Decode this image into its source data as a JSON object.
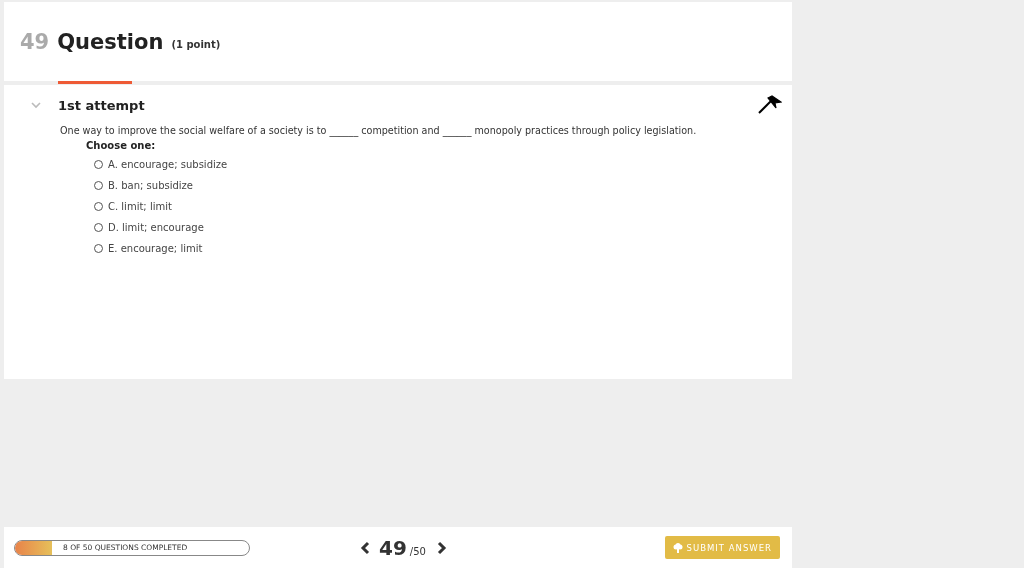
{
  "header": {
    "number": "49",
    "title": "Question",
    "points": "(1 point)"
  },
  "attempt": {
    "title": "1st attempt",
    "flagged": true
  },
  "question": {
    "text": "One way to improve the social welfare of a society is to ______ competition and ______ monopoly practices through policy legislation.",
    "prompt": "Choose one:",
    "options": [
      {
        "label": "A. encourage; subsidize",
        "selected": false
      },
      {
        "label": "B. ban; subsidize",
        "selected": false
      },
      {
        "label": "C. limit; limit",
        "selected": false
      },
      {
        "label": "D. limit; encourage",
        "selected": false
      },
      {
        "label": "E. encourage; limit",
        "selected": false
      }
    ]
  },
  "footer": {
    "progress": {
      "label": "8 OF 50 QUESTIONS COMPLETED",
      "level": 0.16
    },
    "current": "49",
    "total": "/50",
    "submit": "SUBMIT ANSWER"
  }
}
